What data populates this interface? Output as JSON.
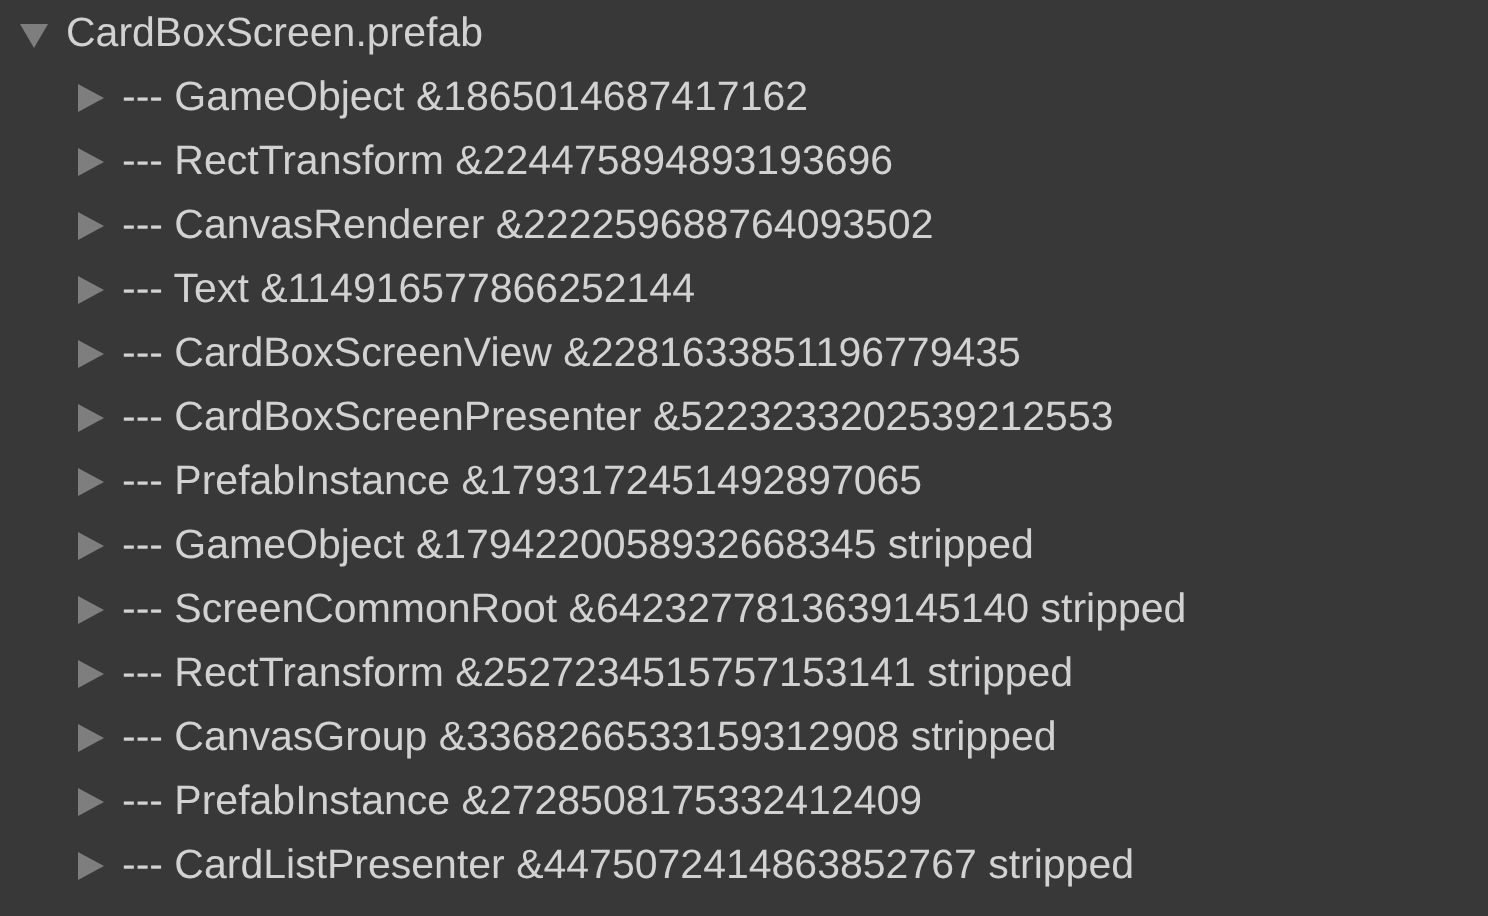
{
  "tree": {
    "label": "CardBoxScreen.prefab",
    "expanded": true,
    "children": [
      {
        "label": "--- GameObject &1865014687417162",
        "expanded": false
      },
      {
        "label": "--- RectTransform &224475894893193696",
        "expanded": false
      },
      {
        "label": "--- CanvasRenderer &222259688764093502",
        "expanded": false
      },
      {
        "label": "--- Text &114916577866252144",
        "expanded": false
      },
      {
        "label": "--- CardBoxScreenView &2281633851196779435",
        "expanded": false
      },
      {
        "label": "--- CardBoxScreenPresenter &5223233202539212553",
        "expanded": false
      },
      {
        "label": "--- PrefabInstance &1793172451492897065",
        "expanded": false
      },
      {
        "label": "--- GameObject &1794220058932668345 stripped",
        "expanded": false
      },
      {
        "label": "--- ScreenCommonRoot &6423277813639145140 stripped",
        "expanded": false
      },
      {
        "label": "--- RectTransform &2527234515757153141 stripped",
        "expanded": false
      },
      {
        "label": "--- CanvasGroup &3368266533159312908 stripped",
        "expanded": false
      },
      {
        "label": "--- PrefabInstance &2728508175332412409",
        "expanded": false
      },
      {
        "label": "--- CardListPresenter &4475072414863852767 stripped",
        "expanded": false
      }
    ]
  }
}
